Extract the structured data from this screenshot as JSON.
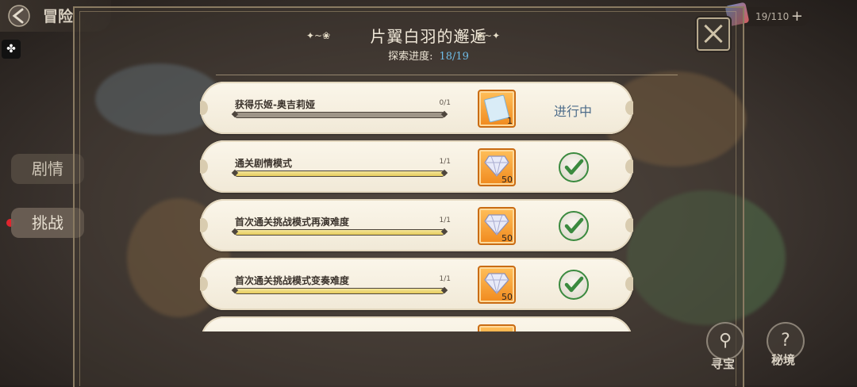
{
  "top_bar": {
    "title": "冒险"
  },
  "side_tabs": [
    {
      "label": "剧情",
      "active": false
    },
    {
      "label": "挑战",
      "active": true
    }
  ],
  "currency": {
    "value": "19/110",
    "plus": "+"
  },
  "header": {
    "title": "片翼白羽的邂逅",
    "progress_label": "探索进度:",
    "progress_value": "18/19"
  },
  "tasks": [
    {
      "name": "获得乐姬-奥吉莉娅",
      "count": "0/1",
      "progress": 0,
      "reward_icon": "ticket-icon",
      "reward_qty": "1",
      "status": "in-progress",
      "status_text": "进行中"
    },
    {
      "name": "通关剧情模式",
      "count": "1/1",
      "progress": 1,
      "reward_icon": "diamond-icon",
      "reward_qty": "50",
      "status": "done",
      "status_text": ""
    },
    {
      "name": "首次通关挑战模式再演难度",
      "count": "1/1",
      "progress": 1,
      "reward_icon": "diamond-icon",
      "reward_qty": "50",
      "status": "done",
      "status_text": ""
    },
    {
      "name": "首次通关挑战模式变奏难度",
      "count": "1/1",
      "progress": 1,
      "reward_icon": "diamond-icon",
      "reward_qty": "50",
      "status": "done",
      "status_text": ""
    }
  ],
  "bottom_nav": [
    {
      "label": "寻宝",
      "icon": "magnifier-icon"
    },
    {
      "label": "秘境",
      "icon": "question-icon"
    }
  ],
  "colors": {
    "accent_blue": "#6fbde8",
    "check_green": "#3a8a3f",
    "reward_orange": "#f08a1e"
  }
}
